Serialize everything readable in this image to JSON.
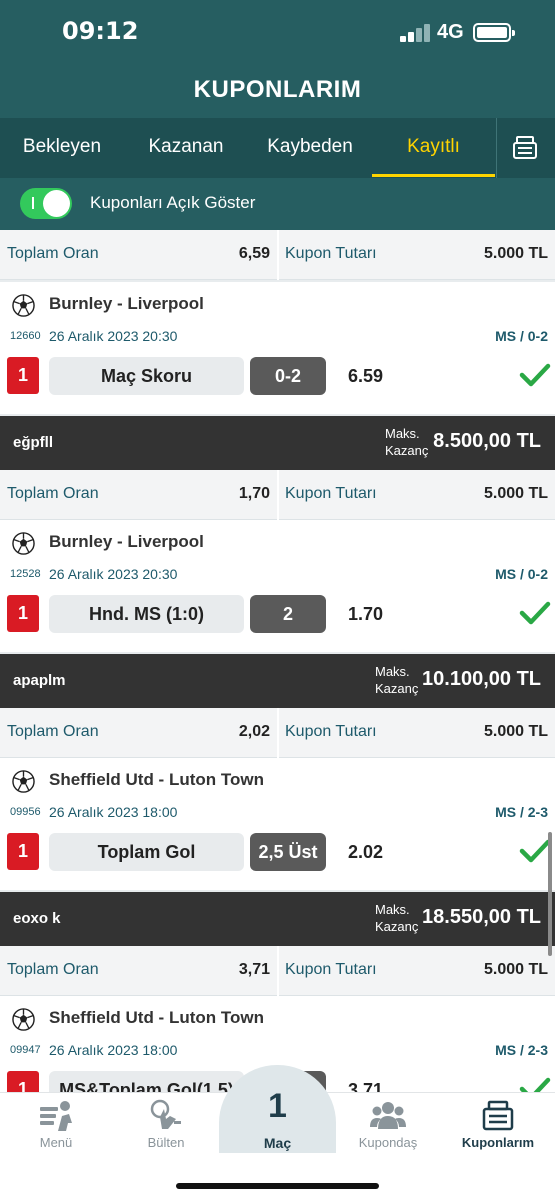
{
  "status_bar": {
    "time": "09:12",
    "network": "4G"
  },
  "app": {
    "title": "KUPONLARIM"
  },
  "tabs": [
    {
      "label": "Bekleyen",
      "active": false
    },
    {
      "label": "Kazanan",
      "active": false
    },
    {
      "label": "Kaybeden",
      "active": false
    },
    {
      "label": "Kayıtlı",
      "active": true
    }
  ],
  "toggle": {
    "label": "Kuponları Açık Göster",
    "on": true
  },
  "labels": {
    "total_odds": "Toplam Oran",
    "coupon_amount": "Kupon Tutarı",
    "max_win": "Maks.\nKazanç"
  },
  "coupons": [
    {
      "name": "",
      "max_win": "",
      "total_odds": "6,59",
      "amount": "5.000 TL",
      "match": {
        "teams": "Burnley - Liverpool",
        "code": "12660",
        "date": "26 Aralık 2023 20:30",
        "score": "MS / 0-2",
        "index": "1",
        "market": "Maç Skoru",
        "pick": "0-2",
        "odd": "6.59"
      }
    },
    {
      "name": "eğpfll",
      "max_win": "8.500,00 TL",
      "total_odds": "1,70",
      "amount": "5.000 TL",
      "match": {
        "teams": "Burnley - Liverpool",
        "code": "12528",
        "date": "26 Aralık 2023 20:30",
        "score": "MS / 0-2",
        "index": "1",
        "market": "Hnd. MS (1:0)",
        "pick": "2",
        "odd": "1.70"
      }
    },
    {
      "name": "apaplm",
      "max_win": "10.100,00 TL",
      "total_odds": "2,02",
      "amount": "5.000 TL",
      "match": {
        "teams": "Sheffield Utd - Luton Town",
        "code": "09956",
        "date": "26 Aralık 2023 18:00",
        "score": "MS / 2-3",
        "index": "1",
        "market": "Toplam Gol",
        "pick": "2,5 Üst",
        "odd": "2.02"
      }
    },
    {
      "name": "eoxo k",
      "max_win": "18.550,00 TL",
      "total_odds": "3,71",
      "amount": "5.000 TL",
      "match": {
        "teams": "Sheffield Utd - Luton Town",
        "code": "09947",
        "date": "26 Aralık 2023 18:00",
        "score": "MS / 2-3",
        "index": "1",
        "market": "MS&Toplam Gol(1,5)",
        "pick": "2 & Üst",
        "odd": "3.71"
      }
    }
  ],
  "bottom_nav": [
    {
      "label": "Menü",
      "icon": "menu-person-icon",
      "active": false
    },
    {
      "label": "Bülten",
      "icon": "bulletin-icon",
      "active": false
    },
    {
      "label": "Maç",
      "badge": "1",
      "active": false
    },
    {
      "label": "Kupondaş",
      "icon": "people-icon",
      "active": false
    },
    {
      "label": "Kuponlarım",
      "icon": "coupons-icon",
      "active": true
    }
  ],
  "colors": {
    "header_teal": "#265e61",
    "tab_bar": "#1e4f52",
    "active_tab": "#ffd400",
    "toggle_green": "#33c95c",
    "index_red": "#d91b24",
    "check_green": "#2aa845",
    "coupon_header": "#333333"
  }
}
